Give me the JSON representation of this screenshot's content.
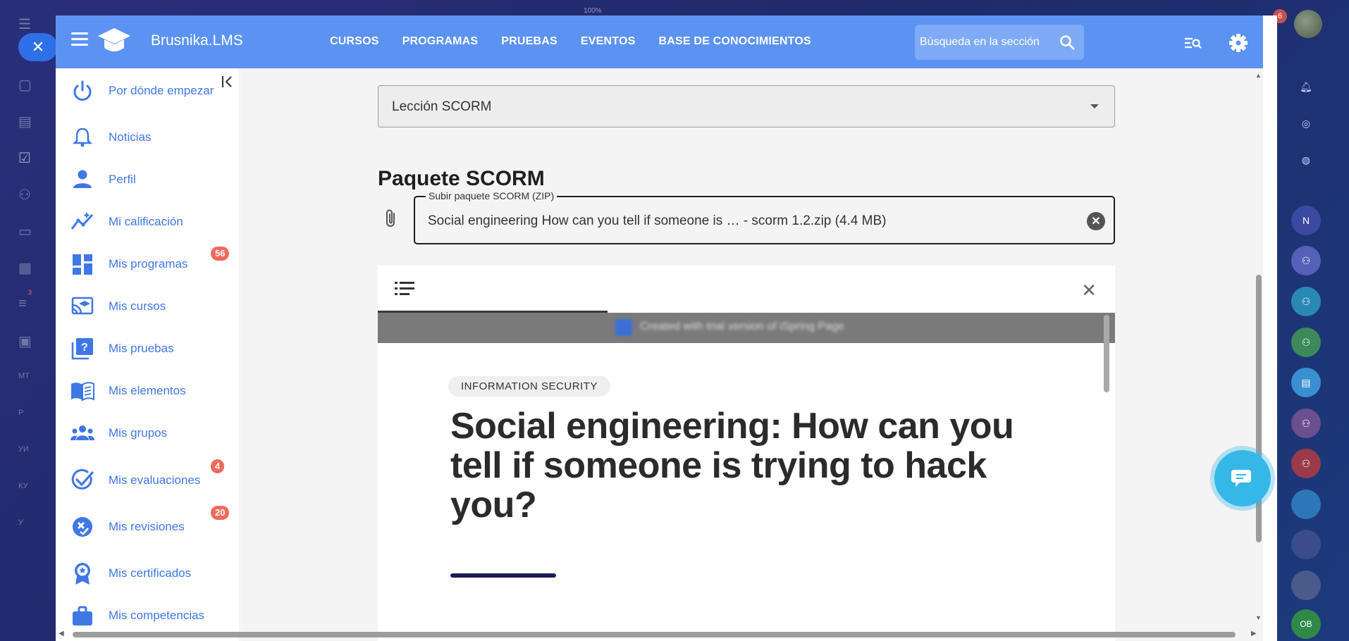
{
  "browser": {
    "zoom": "100%"
  },
  "background": {
    "notification_count": "6",
    "left_badge": "3",
    "right_rail": [
      "N",
      "OB"
    ],
    "left_rail": [
      "MT",
      "P",
      "УИ",
      "КУ",
      "У"
    ]
  },
  "header": {
    "brand": "Brusnika.LMS",
    "nav": [
      "CURSOS",
      "PROGRAMAS",
      "PRUEBAS",
      "EVENTOS",
      "BASE DE CONOCIMIENTOS"
    ],
    "search_placeholder": "Búsqueda en la sección"
  },
  "sidebar": {
    "items": [
      {
        "label": "Por dónde empezar",
        "icon": "power-icon"
      },
      {
        "label": "Noticias",
        "icon": "bell-icon"
      },
      {
        "label": "Perfil",
        "icon": "person-icon"
      },
      {
        "label": "Mi calificación",
        "icon": "chart-icon"
      },
      {
        "label": "Mis programas",
        "icon": "dashboard-icon",
        "badge": "56"
      },
      {
        "label": "Mis cursos",
        "icon": "cast-education-icon"
      },
      {
        "label": "Mis pruebas",
        "icon": "quiz-icon"
      },
      {
        "label": "Mis elementos",
        "icon": "book-icon"
      },
      {
        "label": "Mis grupos",
        "icon": "groups-icon"
      },
      {
        "label": "Mis evaluaciones",
        "icon": "check-circle-icon",
        "badge": "4"
      },
      {
        "label": "Mis revisiones",
        "icon": "review-icon",
        "badge": "20"
      },
      {
        "label": "Mis certificados",
        "icon": "award-icon"
      },
      {
        "label": "Mis competencias",
        "icon": "briefcase-icon"
      }
    ]
  },
  "form": {
    "lesson_type": "Lección SCORM",
    "section_title": "Paquete SCORM",
    "upload_label": "Subir paquete SCORM (ZIP)",
    "upload_value": "Social engineering How can you tell if someone is … - scorm 1.2.zip (4.4 MB)"
  },
  "player": {
    "trial_notice": "Created with trial version of iSpring Page",
    "tag": "INFORMATION SECURITY",
    "headline": "Social engineering: How can you tell if someone is trying to hack you?"
  },
  "colors": {
    "header": "#5c93f3",
    "accent": "#3f77e6",
    "badge": "#ef6a5c",
    "chat": "#35b8e8"
  }
}
